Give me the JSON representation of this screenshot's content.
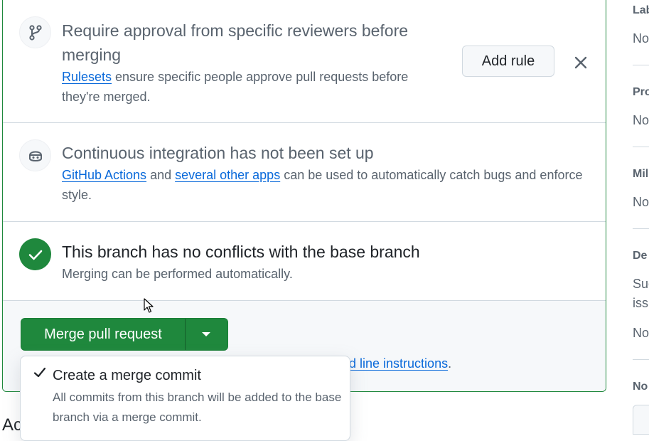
{
  "sections": {
    "review": {
      "title": "Require approval from specific reviewers before merging",
      "link": "Rulesets",
      "desc_rest": " ensure specific people approve pull requests before they're merged.",
      "add_rule": "Add rule"
    },
    "ci": {
      "title": "Continuous integration has not been set up",
      "link1": "GitHub Actions",
      "and": " and ",
      "link2": "several other apps",
      "desc_rest": " can be used to automatically catch bugs and enforce style."
    },
    "conflicts": {
      "title": "This branch has no conflicts with the base branch",
      "desc": "Merging can be performed automatically."
    }
  },
  "merge": {
    "button": "Merge pull request",
    "cmdline_link": "nd line instructions",
    "cmdline_period": "."
  },
  "dropdown": {
    "items": [
      {
        "title": "Create a merge commit",
        "desc": "All commits from this branch will be added to the base branch via a merge commit.",
        "checked": true
      }
    ]
  },
  "sidebar": {
    "labels": "Lab",
    "labels_value": "No",
    "projects": "Pro",
    "projects_value": "No",
    "milestone": "Mil",
    "milestone_value": "No",
    "development": "De",
    "development_desc1": "Suc",
    "development_desc2": "issu",
    "development_value": "No",
    "notifications": "No"
  },
  "bottom_heading": "Ac",
  "colors": {
    "accent_green": "#1f883d",
    "link_blue": "#0969da",
    "border": "#d1d9e0"
  },
  "icons": [
    "git-branch-icon",
    "copilot-bot-icon",
    "check-icon",
    "x-icon",
    "triangle-down-icon"
  ]
}
